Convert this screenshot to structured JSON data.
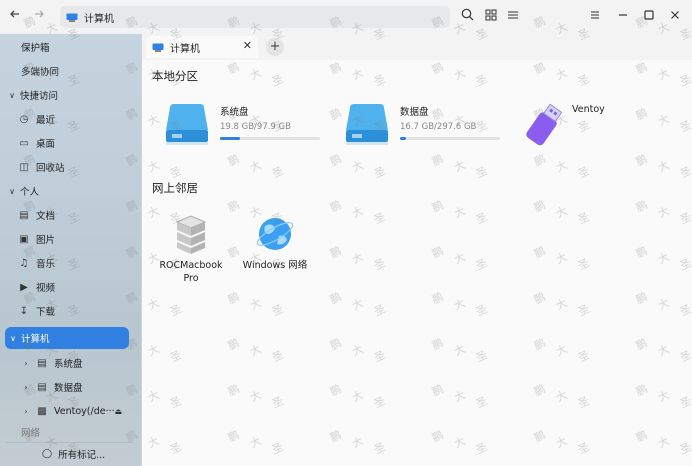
{
  "titlebar": {
    "address": "计算机",
    "back_icon": "arrow-left-icon",
    "forward_icon": "arrow-right-icon",
    "search_icon": "search-icon",
    "grid_icon": "grid-view-icon",
    "list_icon": "list-view-icon",
    "menu_icon": "menu-icon",
    "minimize_icon": "minimize-icon",
    "maximize_icon": "maximize-icon",
    "close_icon": "close-icon"
  },
  "sidebar": {
    "safe": "保护箱",
    "multi": "多端协同",
    "quick_access": "快捷访问",
    "recent": "最近",
    "desktop": "桌面",
    "trash": "回收站",
    "personal": "个人",
    "documents": "文档",
    "pictures": "图片",
    "music": "音乐",
    "videos": "视频",
    "downloads": "下载",
    "computer": "计算机",
    "system_disk": "系统盘",
    "data_disk": "数据盘",
    "ventoy": "Ventoy(/de···",
    "network": "网络",
    "all_tags": "所有标记..."
  },
  "tab": {
    "label": "计算机"
  },
  "main": {
    "local_title": "本地分区",
    "network_title": "网上邻居",
    "drives": [
      {
        "name": "系统盘",
        "size": "19.8 GB/97.9 GB",
        "usage": 0.2
      },
      {
        "name": "数据盘",
        "size": "16.7 GB/297.6 GB",
        "usage": 0.06
      },
      {
        "name": "Ventoy",
        "size": "",
        "usage": 0
      }
    ],
    "network_items": [
      {
        "name": "ROCMacbookPro"
      },
      {
        "name": "Windows 网络"
      }
    ]
  },
  "colors": {
    "accent": "#2f80e0",
    "disk": "#3fa3ea",
    "usb": "#8a5cf0"
  }
}
